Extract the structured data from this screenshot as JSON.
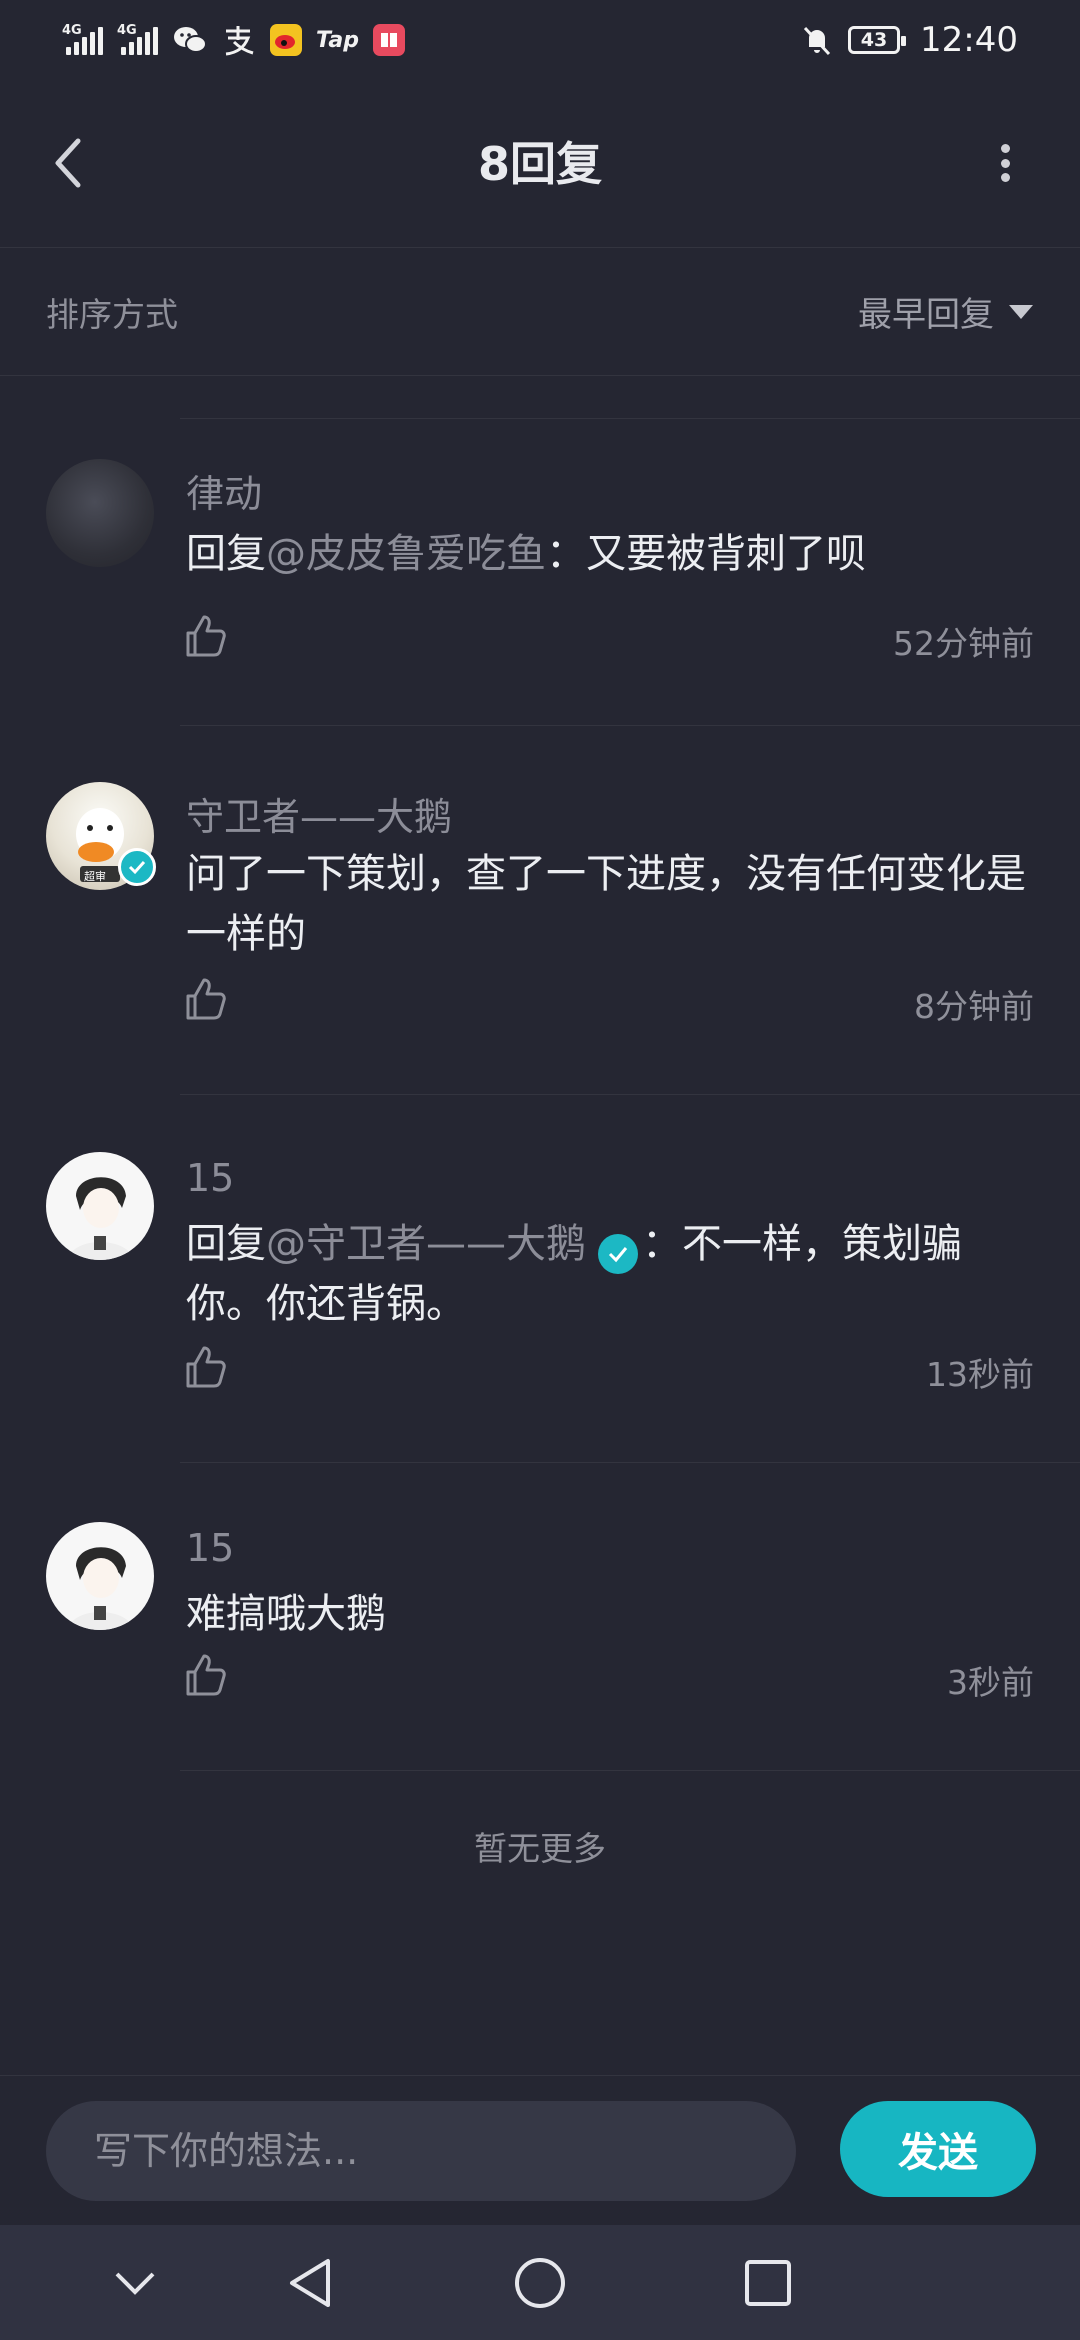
{
  "status_bar": {
    "signal1": "4G",
    "signal2": "4G",
    "tap_label": "Tap",
    "battery": "43",
    "time": "12:40"
  },
  "header": {
    "title": "8回复",
    "back_icon": "chevron-left-icon",
    "more_icon": "more-vertical-icon"
  },
  "sort": {
    "label": "排序方式",
    "selected": "最早回复",
    "icon": "caret-down-icon"
  },
  "comments": [
    {
      "username": "律动",
      "reply_prefix": "回复",
      "mention": "@皮皮鲁爱吃鱼",
      "text": "：又要被背刺了呗",
      "time": "52分钟前"
    },
    {
      "username": "守卫者——大鹅",
      "avatar_badge": "超审",
      "text": "问了一下策划，查了一下进度，没有任何变化是一样的",
      "time": "8分钟前"
    },
    {
      "username": "15",
      "reply_prefix": "回复",
      "mention": "@守卫者——大鹅",
      "text": "：不一样，策划骗你。你还背锅。",
      "time": "13秒前"
    },
    {
      "username": "15",
      "text": "难搞哦大鹅",
      "time": "3秒前"
    }
  ],
  "footer_note": "暂无更多",
  "composer": {
    "placeholder": "写下你的想法...",
    "send_label": "发送"
  },
  "colors": {
    "background": "#252632",
    "accent": "#17b6c2",
    "muted_text": "#8f909a"
  }
}
